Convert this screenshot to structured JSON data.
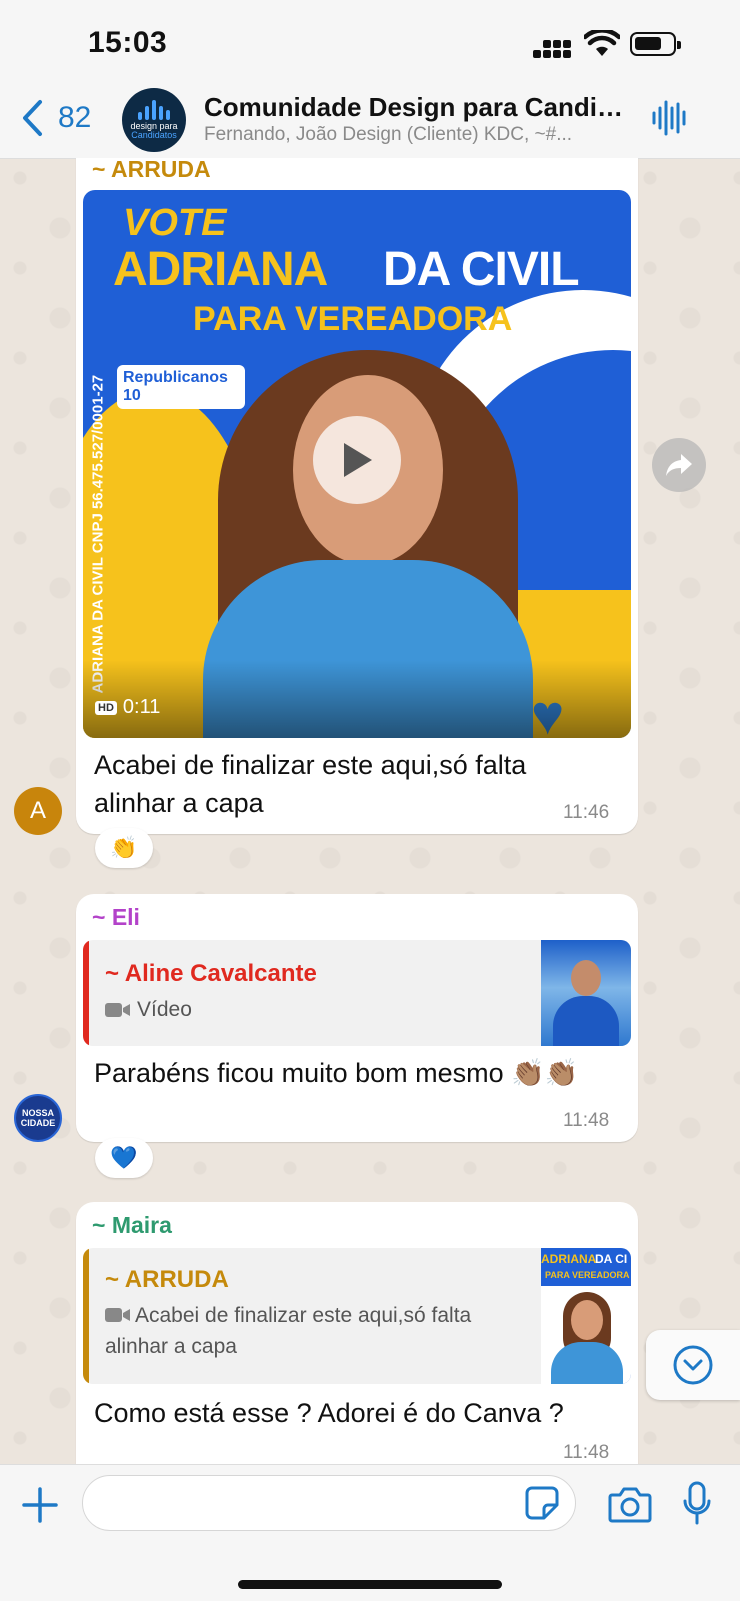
{
  "status_bar": {
    "time": "15:03"
  },
  "header": {
    "back_count": "82",
    "group_name": "Comunidade Design para Candidatos",
    "group_avatar_text_1": "design para",
    "group_avatar_text_2": "Candidatos",
    "members": "Fernando, João Design (Cliente) KDC, ~#..."
  },
  "messages": [
    {
      "sender": "~ ARRUDA",
      "sender_color": "#c58a0c",
      "video": {
        "duration": "0:11",
        "quality": "HD",
        "poster_vote": "VOTE",
        "poster_name_1": "ADRIANA",
        "poster_name_2": "DA CIVIL",
        "poster_role": "PARA VEREADORA",
        "poster_party": "Republicanos 10",
        "poster_cnpj": "ADRIANA DA CIVIL CNPJ 56.475.527/0001-27"
      },
      "text": "Acabei de finalizar este aqui,só falta alinhar a capa",
      "time": "11:46",
      "reaction": "👏",
      "avatar_letter": "A"
    },
    {
      "sender": "~ Eli",
      "sender_color": "#b342c9",
      "quote": {
        "name": "~ Aline Cavalcante",
        "name_color": "#e0291f",
        "type_label": "Vídeo"
      },
      "text": "Parabéns ficou muito bom mesmo 👏🏽👏🏽",
      "time": "11:48",
      "reaction": "💙",
      "avatar_text": "NOSSA CIDADE"
    },
    {
      "sender": "~ Maira",
      "sender_color": "#2e9a6f",
      "quote": {
        "name": "~ ARRUDA",
        "name_color": "#c58a0c",
        "text": "Acabei de finalizar este aqui,só falta alinhar a capa",
        "thumb_1": "ADRIANA",
        "thumb_2": "DA CI",
        "thumb_3": "PARA VEREADORA"
      },
      "text": "Como está esse ? Adorei é do Canva ?",
      "time": "11:48"
    }
  ]
}
